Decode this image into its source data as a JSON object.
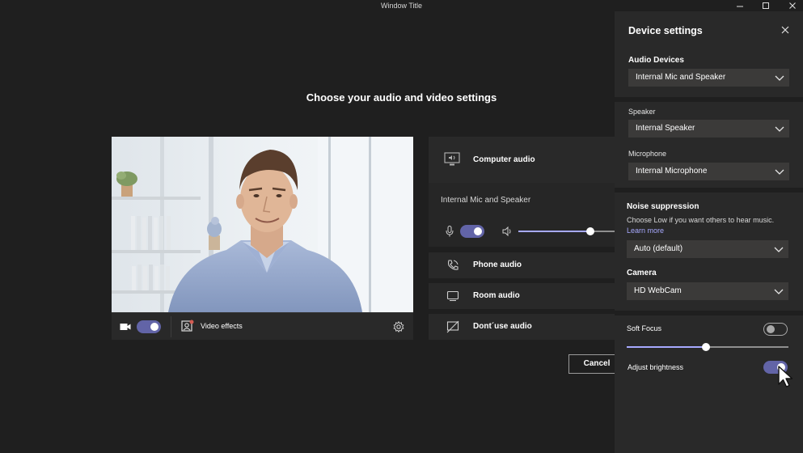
{
  "window": {
    "title": "Window Title"
  },
  "main": {
    "title": "Choose your audio and video settings",
    "video_effects_label": "Video effects",
    "cancel_label": "Cancel"
  },
  "audio": {
    "computer_audio_label": "Computer audio",
    "device_name": "Internal Mic and Speaker",
    "mic_on": true,
    "volume_level": 0.75,
    "phone_audio_label": "Phone audio",
    "room_audio_label": "Room audio",
    "dont_use_audio_label": "Dont´use audio"
  },
  "device_settings": {
    "title": "Device settings",
    "audio_devices_label": "Audio Devices",
    "audio_devices_value": "Internal Mic and Speaker",
    "speaker_label": "Speaker",
    "speaker_value": "Internal Speaker",
    "microphone_label": "Microphone",
    "microphone_value": "Internal Microphone",
    "noise_label": "Noise suppression",
    "noise_hint": "Choose Low if you want others to hear music.",
    "learn_more": "Learn more",
    "noise_value": "Auto (default)",
    "camera_label": "Camera",
    "camera_value": "HD WebCam",
    "soft_focus_label": "Soft Focus",
    "soft_focus_on": false,
    "soft_focus_level": 0.49,
    "brightness_label": "Adjust brightness",
    "brightness_on": true
  },
  "colors": {
    "accent": "#6264a7",
    "link": "#a7a9ff",
    "panel": "#292929",
    "background": "#1f1f1f"
  }
}
